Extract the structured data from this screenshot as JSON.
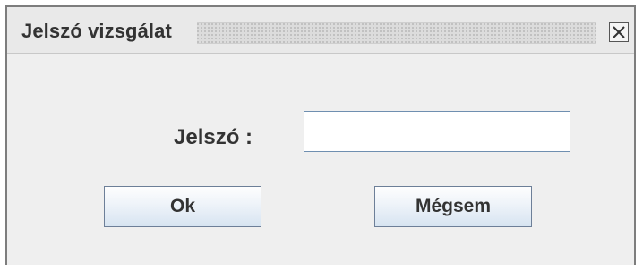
{
  "dialog": {
    "title": "Jelszó vizsgálat",
    "password_label": "Jelszó :",
    "password_value": "",
    "ok_label": "Ok",
    "cancel_label": "Mégsem"
  }
}
